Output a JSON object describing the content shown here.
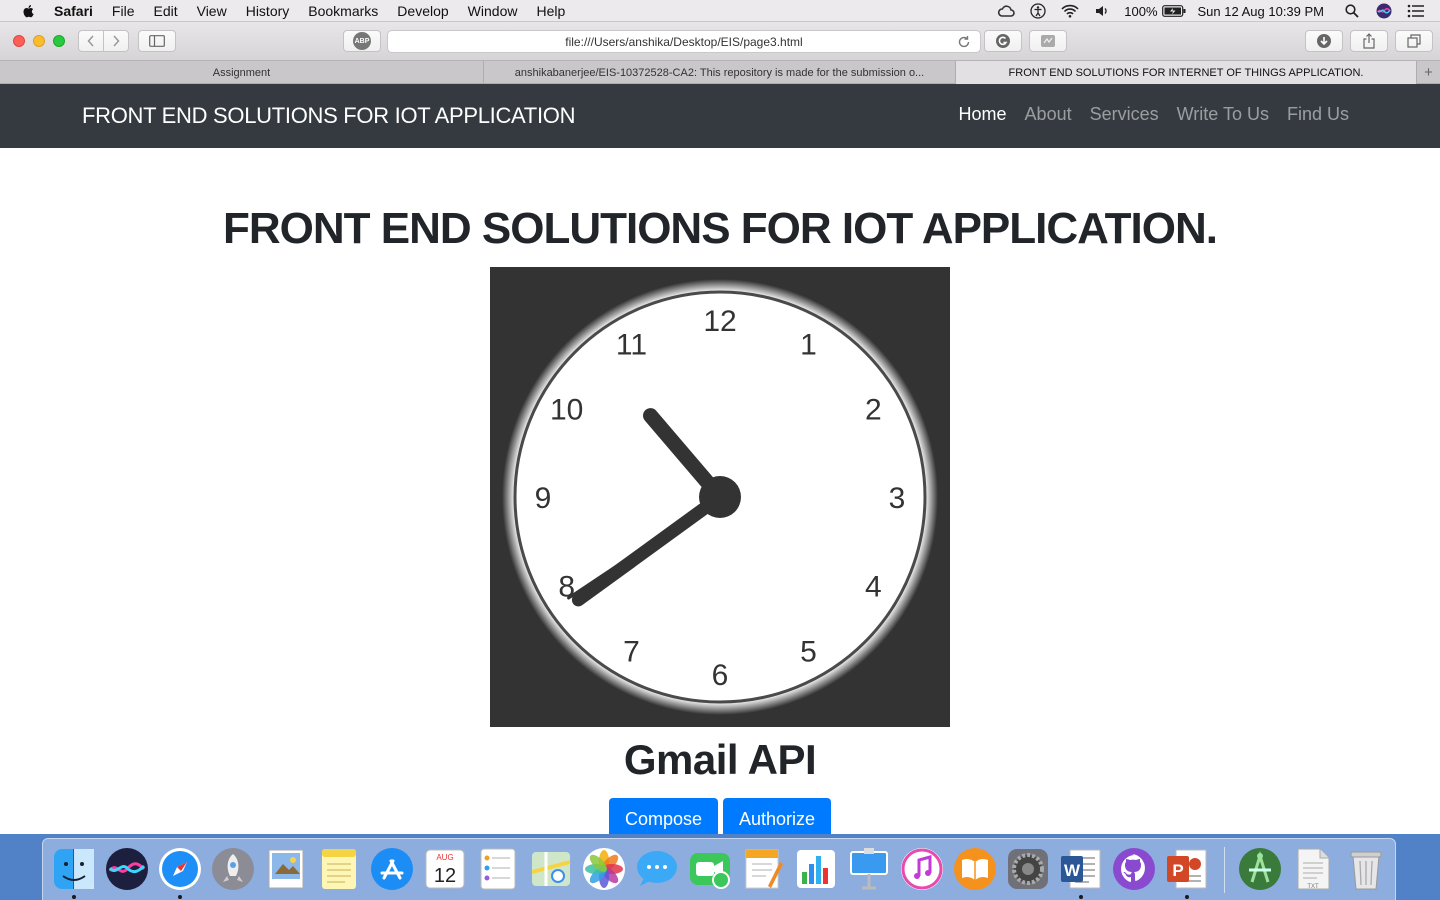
{
  "menubar": {
    "app_name": "Safari",
    "items": [
      "File",
      "Edit",
      "View",
      "History",
      "Bookmarks",
      "Develop",
      "Window",
      "Help"
    ],
    "battery_text": "100%",
    "datetime": "Sun 12 Aug  10:39 PM"
  },
  "toolbar": {
    "url": "file:///Users/anshika/Desktop/EIS/page3.html",
    "adblock_label": "ABP"
  },
  "tabs": [
    {
      "label": "Assignment"
    },
    {
      "label": "anshikabanerjee/EIS-10372528-CA2: This repository is made for the submission o..."
    },
    {
      "label": "FRONT END SOLUTIONS FOR INTERNET OF THINGS APPLICATION."
    }
  ],
  "tab_add_label": "+",
  "page": {
    "brand": "FRONT END SOLUTIONS FOR IOT APPLICATION",
    "nav": [
      {
        "label": "Home",
        "active": true
      },
      {
        "label": "About",
        "active": false
      },
      {
        "label": "Services",
        "active": false
      },
      {
        "label": "Write To Us",
        "active": false
      },
      {
        "label": "Find Us",
        "active": false
      }
    ],
    "heading": "FRONT END SOLUTIONS FOR IOT APPLICATION.",
    "clock": {
      "numbers": [
        "12",
        "1",
        "2",
        "3",
        "4",
        "5",
        "6",
        "7",
        "8",
        "9",
        "10",
        "11"
      ],
      "hour": 10,
      "minute": 39
    },
    "api_heading": "Gmail API",
    "compose_label": "Compose",
    "authorize_label": "Authorize"
  },
  "colors": {
    "navbar_bg": "#343a40",
    "primary_button": "#007bff",
    "clock_bg": "#333333"
  },
  "dock": {
    "icons": [
      "finder-icon",
      "siri-icon",
      "safari-icon",
      "launchpad-icon",
      "preview-icon",
      "notes-icon",
      "app-store-icon",
      "calendar-icon",
      "reminders-icon",
      "maps-icon",
      "photos-icon",
      "messages-icon",
      "facetime-icon",
      "pages-icon",
      "numbers-icon",
      "keynote-icon",
      "itunes-icon",
      "ibooks-icon",
      "system-preferences-icon",
      "word-icon",
      "github-desktop-icon",
      "powerpoint-icon",
      "android-studio-icon",
      "text-file-icon",
      "trash-icon"
    ],
    "calendar_month": "AUG",
    "calendar_day": "12",
    "word_letter": "W",
    "powerpoint_letter": "P",
    "text_file_label": "TXT"
  }
}
